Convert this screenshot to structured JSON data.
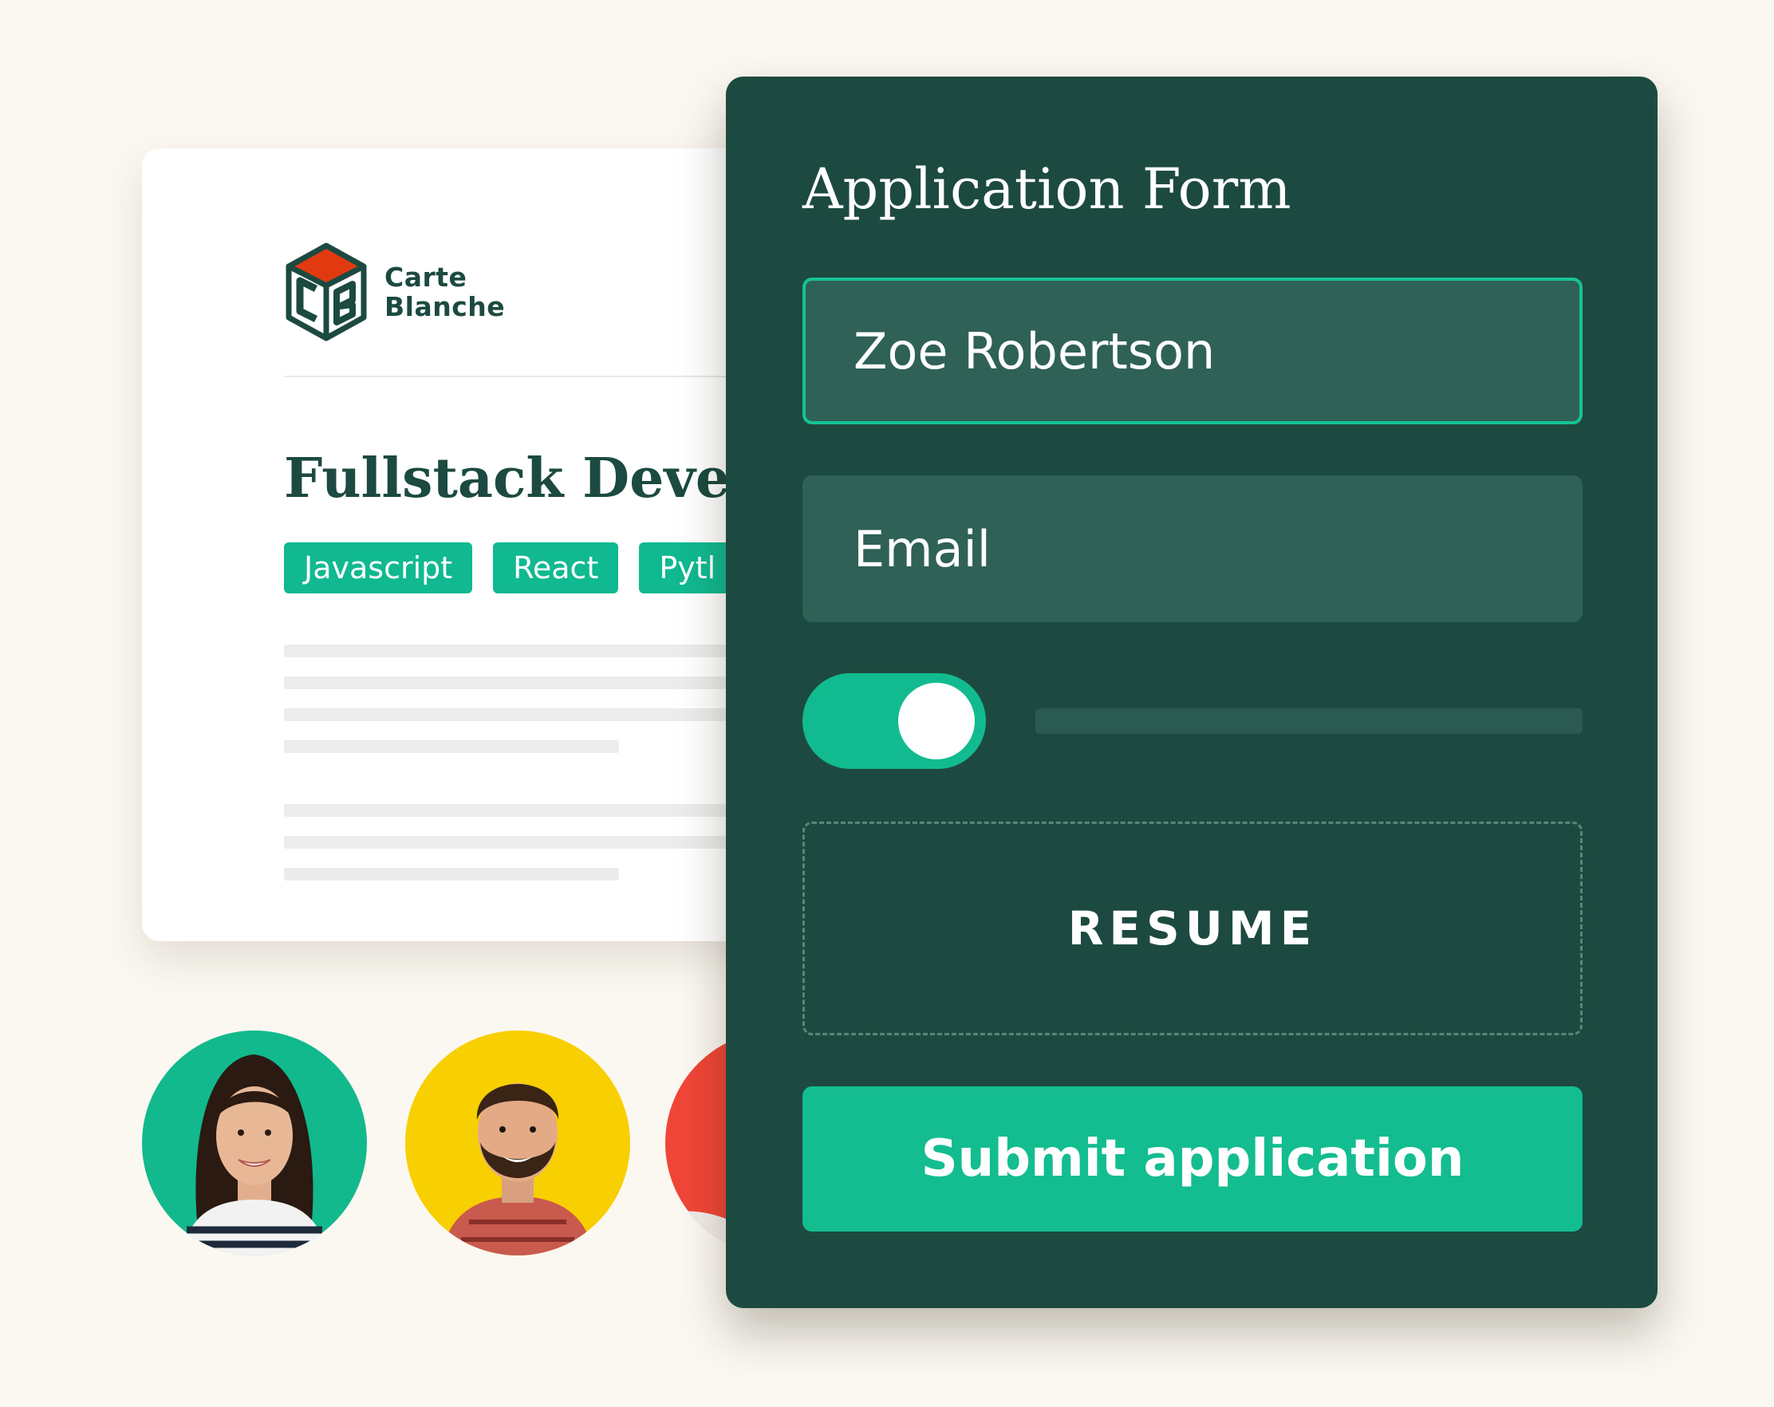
{
  "brand": {
    "name_line1": "Carte",
    "name_line2": "Blanche"
  },
  "job": {
    "title": "Fullstack Develo",
    "tags": [
      "Javascript",
      "React",
      "Pytl"
    ]
  },
  "form": {
    "title": "Application Form",
    "name_value": "Zoe Robertson",
    "email_label": "Email",
    "toggle_on": true,
    "upload_label": "RESUME",
    "submit_label": "Submit application"
  },
  "colors": {
    "background": "#fbf8f1",
    "form_bg": "#1d4a40",
    "field_bg": "#2f6157",
    "accent": "#13bd8f",
    "brand_red": "#e23a10",
    "avatar_green": "#12b98c",
    "avatar_yellow": "#f8cf00",
    "avatar_red": "#f04638"
  }
}
